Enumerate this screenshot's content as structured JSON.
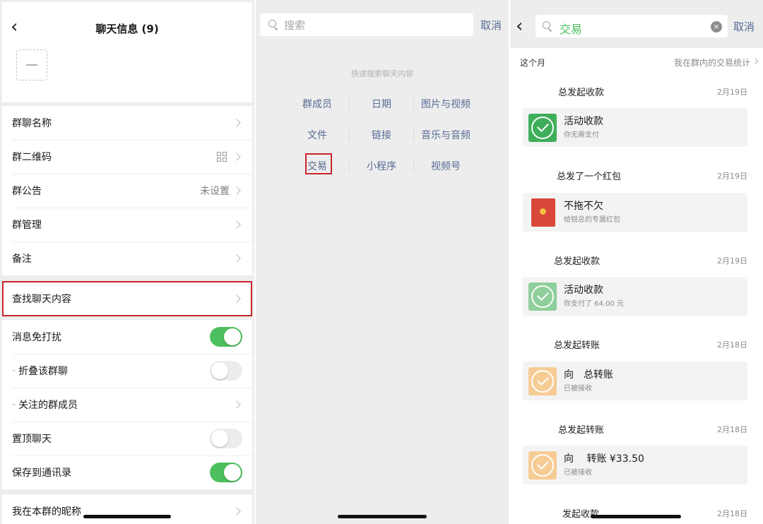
{
  "chat_info": {
    "title": "聊天信息 (9)",
    "rows_group1": [
      {
        "label": "群聊名称"
      },
      {
        "label": "群二维码"
      },
      {
        "label": "群公告",
        "value": "未设置"
      },
      {
        "label": "群管理"
      },
      {
        "label": "备注"
      }
    ],
    "find_label": "查找聊天内容",
    "toggles": [
      {
        "label": "消息免打扰",
        "on": true
      },
      {
        "label": "折叠该群聊",
        "on": false,
        "sub": true
      },
      {
        "label": "关注的群成员",
        "sub": true
      },
      {
        "label": "置顶聊天",
        "on": false
      },
      {
        "label": "保存到通讯录",
        "on": true
      }
    ],
    "nickname_label": "我在本群的昵称"
  },
  "search_panel": {
    "placeholder": "搜索",
    "cancel": "取消",
    "hint": "快速搜索聊天内容",
    "categories": [
      [
        "群成员",
        "日期",
        "图片与视频"
      ],
      [
        "文件",
        "链接",
        "音乐与音频"
      ],
      [
        "交易",
        "小程序",
        "视频号"
      ]
    ]
  },
  "results_panel": {
    "query": "交易",
    "cancel": "取消",
    "month": "这个月",
    "stats": "我在群内的交易统计",
    "items": [
      {
        "title": "总发起收款",
        "date": "2月19日",
        "type": "payment",
        "main": "活动收款",
        "sub": "你无需支付"
      },
      {
        "title": "总发了一个红包",
        "date": "2月19日",
        "type": "redpacket",
        "main": "不拖不欠",
        "sub": "给锐总的专属红包"
      },
      {
        "title": "总发起收款",
        "date": "2月19日",
        "type": "payment-done",
        "main": "活动收款",
        "sub": "你支付了 64.00 元"
      },
      {
        "title": "总发起转账",
        "date": "2月18日",
        "type": "transfer",
        "main": "向　总转账",
        "sub": "已被接收"
      },
      {
        "title": "总发起转账",
        "date": "2月18日",
        "type": "transfer",
        "main": "向　 转账 ¥33.50",
        "sub": "已被接收"
      },
      {
        "title": "发起收款",
        "date": "2月18日",
        "type": "partial"
      }
    ]
  },
  "colors": {
    "accent_green": "#4cbf5e",
    "link_blue": "#576b95",
    "highlight_red": "#c9252c",
    "payment_green": "#3fae5a",
    "payment_done_green": "#8fcf9b",
    "transfer_orange": "#f6cc95",
    "redpacket_red": "#d9483a"
  },
  "icons": [
    "back-arrow-icon",
    "chevron-right-icon",
    "qr-code-icon",
    "search-icon",
    "clear-icon",
    "check-circle-icon",
    "red-packet-icon"
  ]
}
